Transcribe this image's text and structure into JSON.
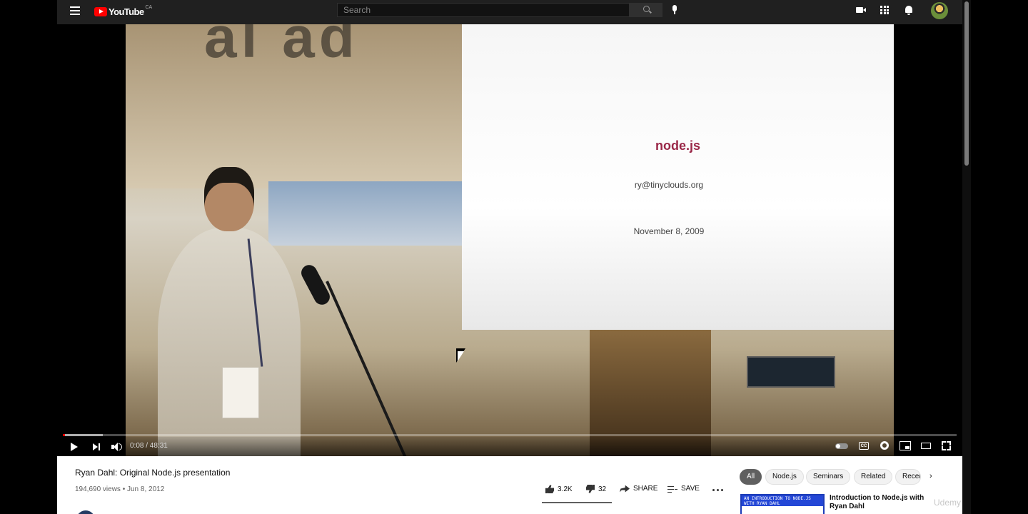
{
  "header": {
    "logo_text": "YouTube",
    "region": "CA",
    "search_placeholder": "Search"
  },
  "video": {
    "slide": {
      "title": "node.js",
      "email": "ry@tinyclouds.org",
      "date": "November 8, 2009"
    },
    "time_display": "0:08 / 48:31",
    "progress_fraction": 0.00275,
    "buffer_fraction": 0.045
  },
  "info": {
    "title": "Ryan Dahl: Original Node.js presentation",
    "views": "194,690 views",
    "date": "Jun 8, 2012",
    "likes": "3.2K",
    "dislikes": "32",
    "share_label": "SHARE",
    "save_label": "SAVE"
  },
  "chips": [
    "All",
    "Node.js",
    "Seminars",
    "Related",
    "Recently uploaded"
  ],
  "recommendation": {
    "thumb_text": "AN INTRODUCTION TO NODE.JS WITH RYAN DAHL",
    "title": "Introduction to Node.js with Ryan Dahl"
  },
  "watermark": "Udemy",
  "colors": {
    "brand_red": "#ff0000",
    "topbar": "#202020",
    "slide_title": "#9a2848"
  }
}
